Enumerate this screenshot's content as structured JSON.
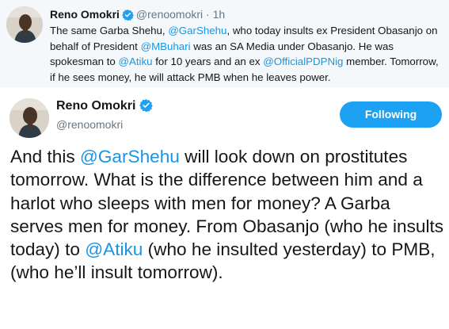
{
  "parent_tweet": {
    "name": "Reno Omokri",
    "handle": "@renoomokri",
    "separator": "·",
    "time": "1h",
    "text_segments": [
      {
        "t": "The same Garba Shehu, ",
        "mention": false
      },
      {
        "t": "@GarShehu",
        "mention": true
      },
      {
        "t": ", who today insults ex President Obasanjo on behalf of President ",
        "mention": false
      },
      {
        "t": "@MBuhari",
        "mention": true
      },
      {
        "t": " was an SA Media under Obasanjo. He was spokesman to ",
        "mention": false
      },
      {
        "t": "@Atiku",
        "mention": true
      },
      {
        "t": " for 10 years and an ex ",
        "mention": false
      },
      {
        "t": "@OfficialPDPNig",
        "mention": true
      },
      {
        "t": " member. Tomorrow, if he sees money, he will attack PMB when he leaves power.",
        "mention": false
      }
    ]
  },
  "main_tweet": {
    "name": "Reno Omokri",
    "handle": "@renoomokri",
    "follow_label": "Following",
    "text_segments": [
      {
        "t": "And this ",
        "mention": false
      },
      {
        "t": "@GarShehu",
        "mention": true
      },
      {
        "t": " will look down on prostitutes tomorrow. What is the difference between him and a harlot who sleeps with men for money? A Garba serves men for money. From Obasanjo (who he insults today) to ",
        "mention": false
      },
      {
        "t": "@Atiku",
        "mention": true
      },
      {
        "t": " (who he insulted yesterday) to PMB, (who he’ll insult tomorrow).",
        "mention": false
      }
    ]
  },
  "colors": {
    "mention": "#1b95e0",
    "verified": "#1da1f2",
    "follow_button": "#1da1f2",
    "parent_background": "#f5f8fa",
    "secondary_text": "#657786"
  },
  "icons": {
    "verified": "verified-badge-icon",
    "avatar": "profile-photo"
  }
}
